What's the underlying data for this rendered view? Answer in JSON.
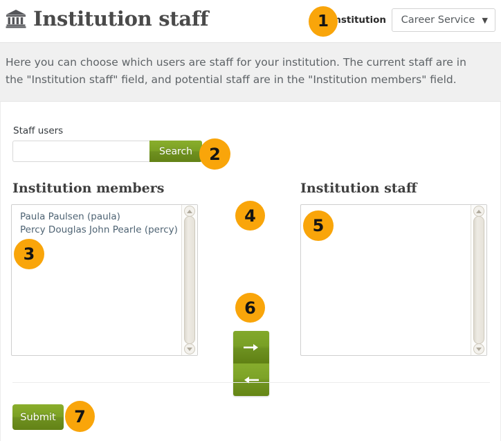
{
  "header": {
    "icon": "bank-institution-icon",
    "title": "Institution staff",
    "institution_label": "Institution",
    "institution_selected": "Career Service",
    "caret_icon": "chevron-down-icon"
  },
  "description": "Here you can choose which users are staff for your institution. The current staff are in the \"Institution staff\" field, and potential staff are in the \"Institution members\" field.",
  "search": {
    "label": "Staff users",
    "value": "",
    "placeholder": "",
    "button_label": "Search"
  },
  "members": {
    "heading": "Institution members",
    "options": [
      "Paula Paulsen (paula)",
      "Percy Douglas John Pearle (percy)"
    ]
  },
  "staff": {
    "heading": "Institution staff",
    "options": []
  },
  "transfer": {
    "add_icon": "arrow-right-icon",
    "remove_icon": "arrow-left-icon"
  },
  "footer": {
    "submit_label": "Submit"
  },
  "badges": {
    "b1": "1",
    "b2": "2",
    "b3": "3",
    "b4": "4",
    "b5": "5",
    "b6": "6",
    "b7": "7"
  },
  "colors": {
    "accent_green": "#7ba024",
    "badge_orange": "#f9a50a",
    "band_gray": "#f0f0f0",
    "option_text": "#4e6373"
  }
}
